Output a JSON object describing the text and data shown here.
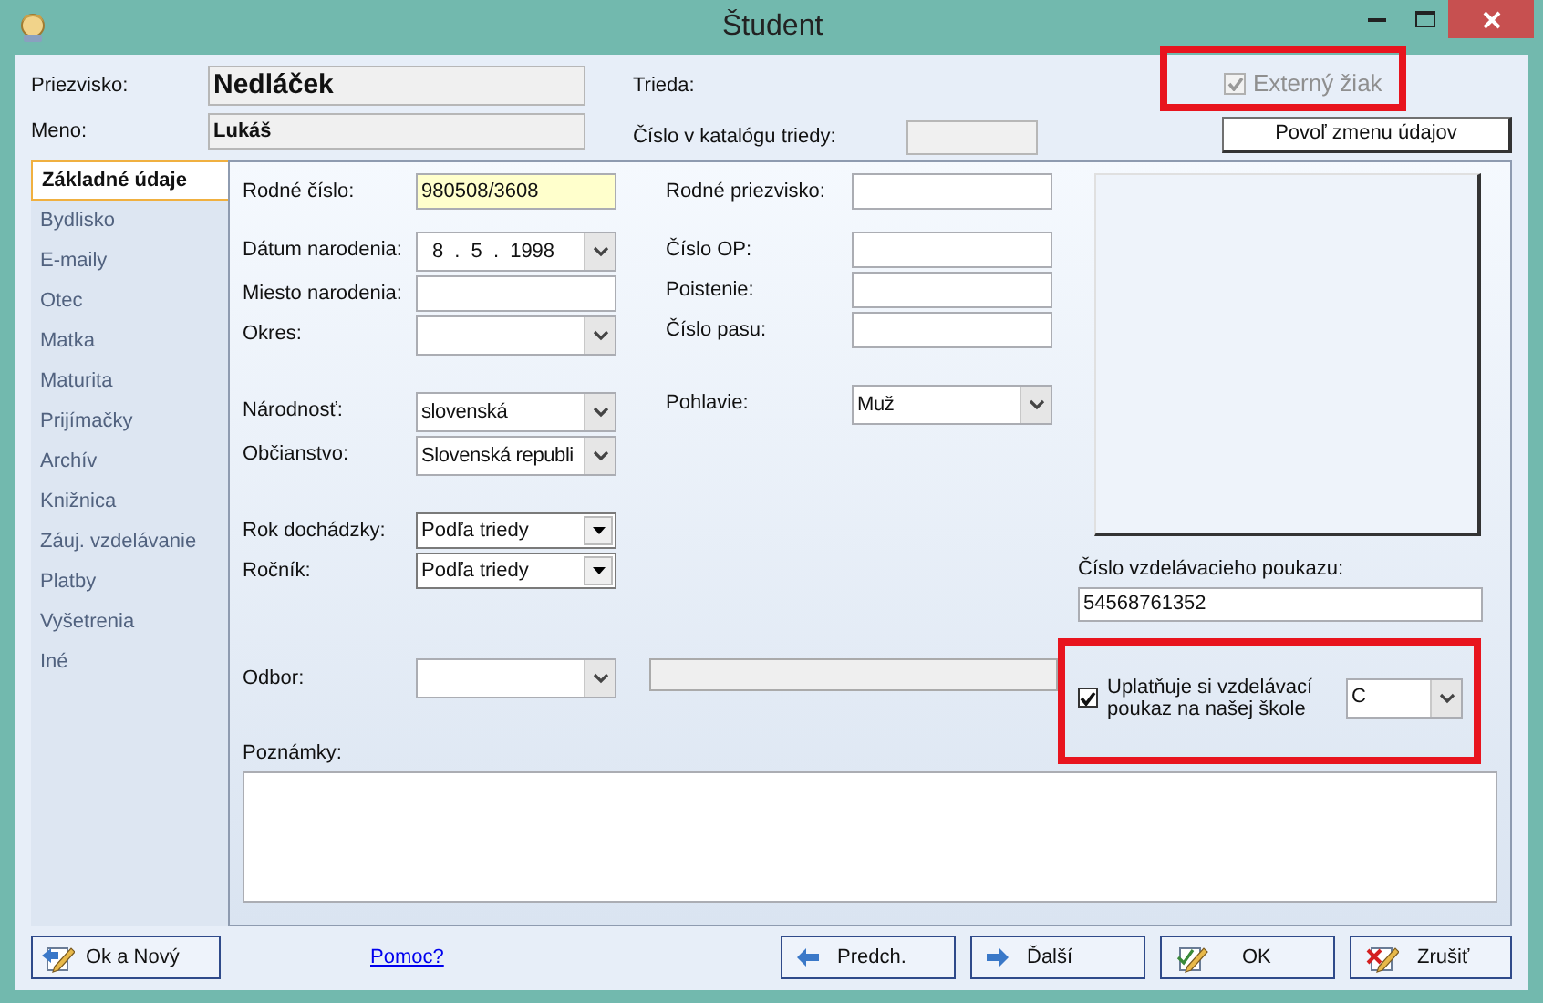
{
  "window": {
    "title": "Študent"
  },
  "header": {
    "surname_label": "Priezvisko:",
    "surname": "Nedláček",
    "name_label": "Meno:",
    "name": "Lukáš",
    "class_label": "Trieda:",
    "catalog_label": "Číslo v katalógu triedy:",
    "external": {
      "label": "Externý žiak",
      "checked": true,
      "disabled": true
    },
    "unlock_button": "Povoľ zmenu údajov"
  },
  "sidebar": {
    "items": [
      {
        "label": "Základné údaje",
        "selected": true
      },
      {
        "label": "Bydlisko",
        "selected": false
      },
      {
        "label": "E-maily",
        "selected": false
      },
      {
        "label": "Otec",
        "selected": false
      },
      {
        "label": "Matka",
        "selected": false
      },
      {
        "label": "Maturita",
        "selected": false
      },
      {
        "label": "Prijímačky",
        "selected": false
      },
      {
        "label": "Archív",
        "selected": false
      },
      {
        "label": "Knižnica",
        "selected": false
      },
      {
        "label": "Záuj. vzdelávanie",
        "selected": false
      },
      {
        "label": "Platby",
        "selected": false
      },
      {
        "label": "Vyšetrenia",
        "selected": false
      },
      {
        "label": "Iné",
        "selected": false
      }
    ]
  },
  "left_groups": [
    [
      {
        "label": "Rodné číslo:",
        "kind": "text",
        "value": "980508/3608",
        "highlighted": true
      }
    ],
    [
      {
        "label": "Dátum narodenia:",
        "kind": "date",
        "value": "8 . 5 . 1998"
      },
      {
        "label": "Miesto narodenia:",
        "kind": "text",
        "highlighted": false
      },
      {
        "label": "Okres:",
        "kind": "combo"
      }
    ],
    [
      {
        "label": "Národnosť:",
        "kind": "combo",
        "value": "slovenská"
      },
      {
        "label": "Občianstvo:",
        "kind": "combo",
        "value": "Slovenská republi"
      }
    ],
    [
      {
        "label": "Rok dochádzky:",
        "kind": "dropdown",
        "value": "Podľa triedy"
      },
      {
        "label": "Ročník:",
        "kind": "dropdown",
        "value": "Podľa triedy"
      }
    ]
  ],
  "middle_groups": [
    [
      {
        "label": "Rodné priezvisko:",
        "kind": "text",
        "highlighted": false
      }
    ],
    [
      {
        "label": "Číslo OP:",
        "kind": "text",
        "highlighted": false
      },
      {
        "label": "Poistenie:",
        "kind": "text",
        "highlighted": false
      },
      {
        "label": "Číslo pasu:",
        "kind": "text",
        "highlighted": false
      }
    ],
    [
      {
        "label": "Pohlavie:",
        "kind": "combo",
        "value": "Muž"
      }
    ]
  ],
  "voucher_number": {
    "label": "Číslo vzdelávacieho poukazu:",
    "value": "54568761352"
  },
  "field_of_study": {
    "label": "Odbor:"
  },
  "voucher": {
    "label": "Uplatňuje si vzdelávací poukaz na našej škole",
    "checked": true,
    "value": "C"
  },
  "notes": {
    "label": "Poznámky:"
  },
  "footer": {
    "ok_new": "Ok a Nový",
    "help": "Pomoc?",
    "buttons": [
      {
        "label": "Predch.",
        "kind": "prev"
      },
      {
        "label": "Ďalší",
        "kind": "next"
      },
      {
        "label": "OK",
        "kind": "ok"
      },
      {
        "label": "Zrušiť",
        "kind": "cancel"
      }
    ]
  }
}
